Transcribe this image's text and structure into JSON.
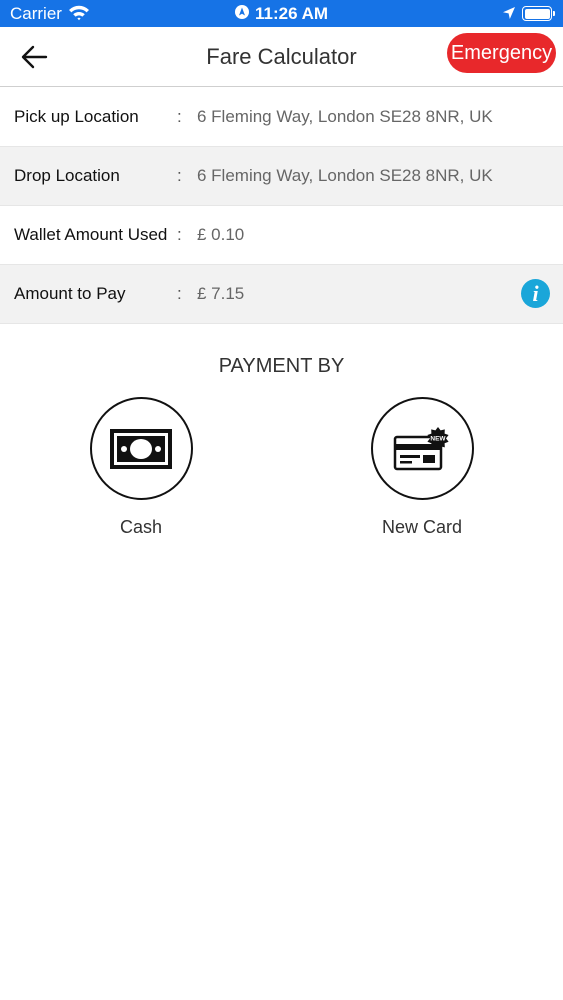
{
  "status_bar": {
    "carrier": "Carrier",
    "time": "11:26 AM"
  },
  "nav": {
    "title": "Fare Calculator",
    "emergency_label": "Emergency",
    "back_icon": "arrow-left-icon"
  },
  "details": [
    {
      "label": "Pick up Location",
      "colon": ":",
      "value": "6 Fleming Way, London SE28 8NR, UK"
    },
    {
      "label": "Drop Location",
      "colon": ":",
      "value": "6 Fleming Way, London SE28 8NR, UK"
    },
    {
      "label": "Wallet Amount Used",
      "colon": ":",
      "value": "£ 0.10"
    },
    {
      "label": "Amount to Pay",
      "colon": ":",
      "value": "£ 7.15",
      "info_icon": "i"
    }
  ],
  "payment": {
    "title": "PAYMENT BY",
    "options": [
      {
        "label": "Cash",
        "icon": "cash-icon"
      },
      {
        "label": "New Card",
        "icon": "new-card-icon",
        "badge": "NEW"
      }
    ]
  },
  "colors": {
    "status_bar": "#1673e6",
    "emergency": "#e8282b",
    "info": "#1aa6d9",
    "row_alt": "#f2f2f2"
  }
}
